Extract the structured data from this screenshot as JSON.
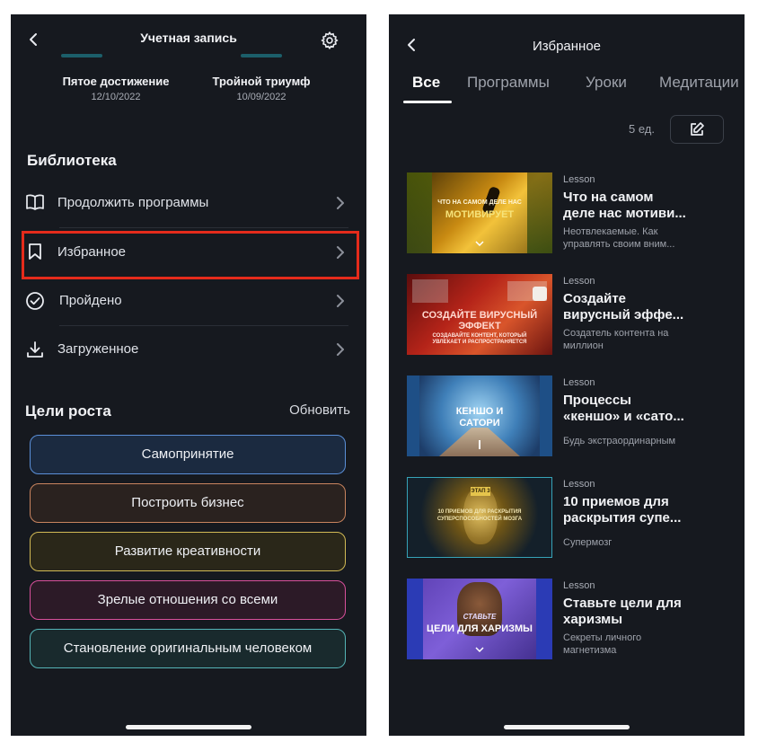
{
  "left_screen": {
    "header": {
      "title": "Учетная запись"
    },
    "achievements": [
      {
        "name": "Пятое достижение",
        "date": "12/10/2022"
      },
      {
        "name": "Тройной триумф",
        "date": "10/09/2022"
      }
    ],
    "library": {
      "title": "Библиотека",
      "items": [
        {
          "label": "Продолжить программы",
          "icon": "book-icon"
        },
        {
          "label": "Избранное",
          "icon": "bookmark-icon"
        },
        {
          "label": "Пройдено",
          "icon": "check-circle-icon"
        },
        {
          "label": "Загруженное",
          "icon": "download-icon"
        }
      ]
    },
    "goals": {
      "title": "Цели роста",
      "refresh_label": "Обновить",
      "items": [
        {
          "label": "Самопринятие",
          "border": "#5b8fd8",
          "fill": "#1b2a40"
        },
        {
          "label": "Построить бизнес",
          "border": "#c9845f",
          "fill": "#2a221f"
        },
        {
          "label": "Развитие креативности",
          "border": "#d2ba55",
          "fill": "#2a2719"
        },
        {
          "label": "Зрелые отношения со всеми",
          "border": "#d8509b",
          "fill": "#2c1a27"
        },
        {
          "label": "Становление оригинальным человеком",
          "border": "#55b4b6",
          "fill": "#192a2d"
        }
      ]
    },
    "highlight_color": "#e52b1b"
  },
  "right_screen": {
    "header": {
      "title": "Избранное"
    },
    "tabs": [
      "Все",
      "Программы",
      "Уроки",
      "Медитации"
    ],
    "active_tab": "Все",
    "count_label": "5 ед.",
    "items": [
      {
        "kind": "Lesson",
        "title": "Что на самом\nделе нас мотиви...",
        "subtitle": "Неотвлекаемые. Как\nуправлять своим вним...",
        "thumb_small": "ЧТО НА САМОМ ДЕЛЕ НАС",
        "thumb_big": "МОТИВИРУЕТ"
      },
      {
        "kind": "Lesson",
        "title": "Создайте\nвирусный эффе...",
        "subtitle": "Создатель контента на\nмиллион",
        "thumb_big": "СОЗДАЙТЕ ВИРУСНЫЙ ЭФФЕКТ",
        "thumb_small": "СОЗДАВАЙТЕ КОНТЕНТ, КОТОРЫЙ УВЛЕКАЕТ И РАСПРОСТРАНЯЕТСЯ"
      },
      {
        "kind": "Lesson",
        "title": "Процессы\n«кеншо» и «сато...",
        "subtitle": "Будь экстраординарным",
        "thumb_big": "КЕНШО И САТОРИ"
      },
      {
        "kind": "Lesson",
        "title": "10 приемов для\nраскрытия супе...",
        "subtitle": "Супермозг",
        "thumb_badge": "ЭТАП 3",
        "thumb_small": "10 ПРИЕМОВ ДЛЯ РАСКРЫТИЯ СУПЕРСПОСОБНОСТЕЙ МОЗГА"
      },
      {
        "kind": "Lesson",
        "title": "Ставьте цели для\nхаризмы",
        "subtitle": "Секреты личного\nмагнетизма",
        "thumb_small": "СТАВЬТЕ",
        "thumb_big": "ЦЕЛИ ДЛЯ ХАРИЗМЫ"
      }
    ]
  }
}
